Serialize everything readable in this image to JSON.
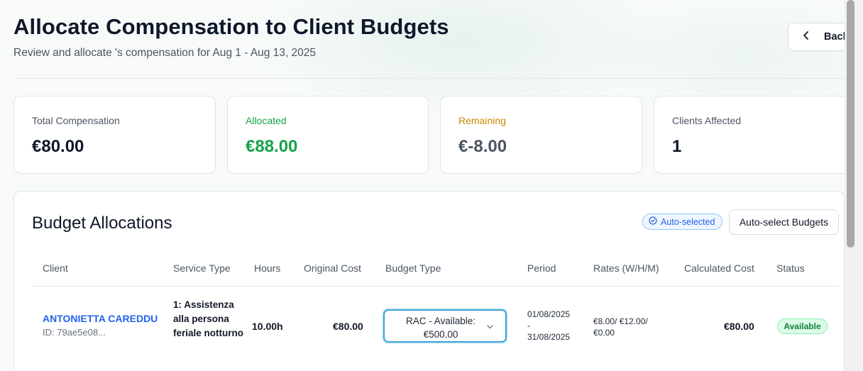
{
  "header": {
    "title": "Allocate Compensation to Client Budgets",
    "subtitle": "Review and allocate 's compensation for Aug 1 - Aug 13, 2025",
    "back_label": "Back"
  },
  "stats": [
    {
      "label": "Total Compensation",
      "value": "€80.00"
    },
    {
      "label": "Allocated",
      "value": "€88.00"
    },
    {
      "label": "Remaining",
      "value": "€-8.00"
    },
    {
      "label": "Clients Affected",
      "value": "1"
    }
  ],
  "allocations": {
    "title": "Budget Allocations",
    "auto_badge": "Auto-selected",
    "auto_button": "Auto-select Budgets",
    "columns": [
      "Client",
      "Service Type",
      "Hours",
      "Original Cost",
      "Budget Type",
      "Period",
      "Rates (W/H/M)",
      "Calculated Cost",
      "Status"
    ],
    "rows": [
      {
        "client_name": "ANTONIETTA CAREDDU",
        "client_id": "ID: 79ae5e08...",
        "service_type": "1: Assistenza alla persona feriale notturno",
        "hours": "10.00h",
        "original_cost": "€80.00",
        "budget_type": "RAC - Available: €500.00",
        "period_start": "01/08/2025",
        "period_sep": "-",
        "period_end": "31/08/2025",
        "rates": "€8.00/ €12.00/ €0.00",
        "calculated_cost": "€80.00",
        "status": "Available"
      }
    ]
  },
  "colors": {
    "accent_blue": "#2563eb",
    "success_green": "#16a34a",
    "warning_amber": "#ca8a04",
    "focus_ring": "#38a3d6"
  },
  "icons": {
    "back": "chevron-left-icon",
    "auto_badge": "check-circle-icon",
    "select": "chevron-down-icon"
  }
}
